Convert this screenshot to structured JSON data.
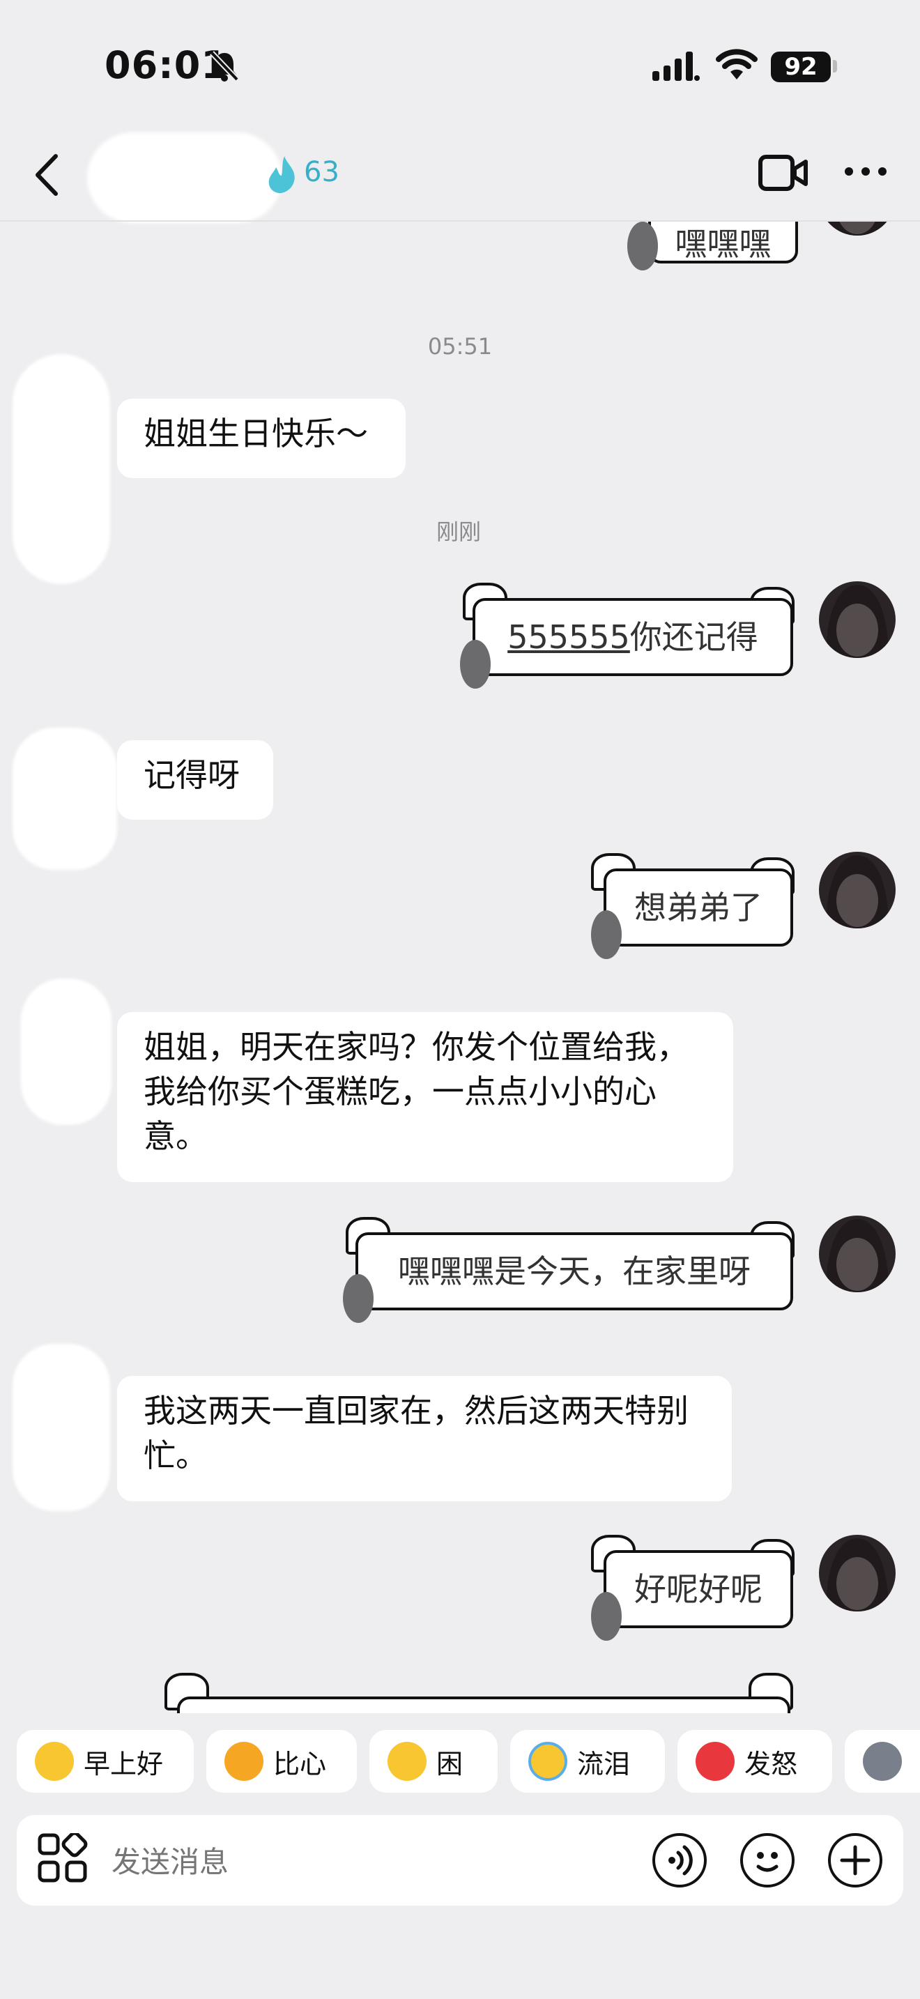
{
  "status_bar": {
    "time": "06:01",
    "battery": "92"
  },
  "header": {
    "streak_count": "63"
  },
  "timestamps": {
    "first": "05:51",
    "second": "刚刚"
  },
  "messages": [
    {
      "side": "out",
      "text": "嘿嘿嘿"
    },
    {
      "side": "in",
      "text": "姐姐生日快乐～"
    },
    {
      "side": "out",
      "text_link": "555555",
      "text_rest": "你还记得"
    },
    {
      "side": "in",
      "text": "记得呀"
    },
    {
      "side": "out",
      "text": "想弟弟了"
    },
    {
      "side": "in",
      "text": "姐姐，明天在家吗？你发个位置给我，我给你买个蛋糕吃，一点点小小的心意。"
    },
    {
      "side": "out",
      "text": "嘿嘿嘿是今天，在家里呀"
    },
    {
      "side": "in",
      "text": "我这两天一直回家在，然后这两天特别忙。"
    },
    {
      "side": "out",
      "text": "好呢好呢"
    }
  ],
  "quick_replies": [
    {
      "label": "早上好",
      "icon": "sun-face-emoji"
    },
    {
      "label": "比心",
      "icon": "heart-hands-emoji"
    },
    {
      "label": "困",
      "icon": "sleepy-face-emoji"
    },
    {
      "label": "流泪",
      "icon": "crying-face-emoji"
    },
    {
      "label": "发怒",
      "icon": "angry-face-emoji"
    }
  ],
  "input": {
    "placeholder": "发送消息"
  },
  "colors": {
    "accent": "#35b0c8",
    "background": "#eeeef0"
  }
}
